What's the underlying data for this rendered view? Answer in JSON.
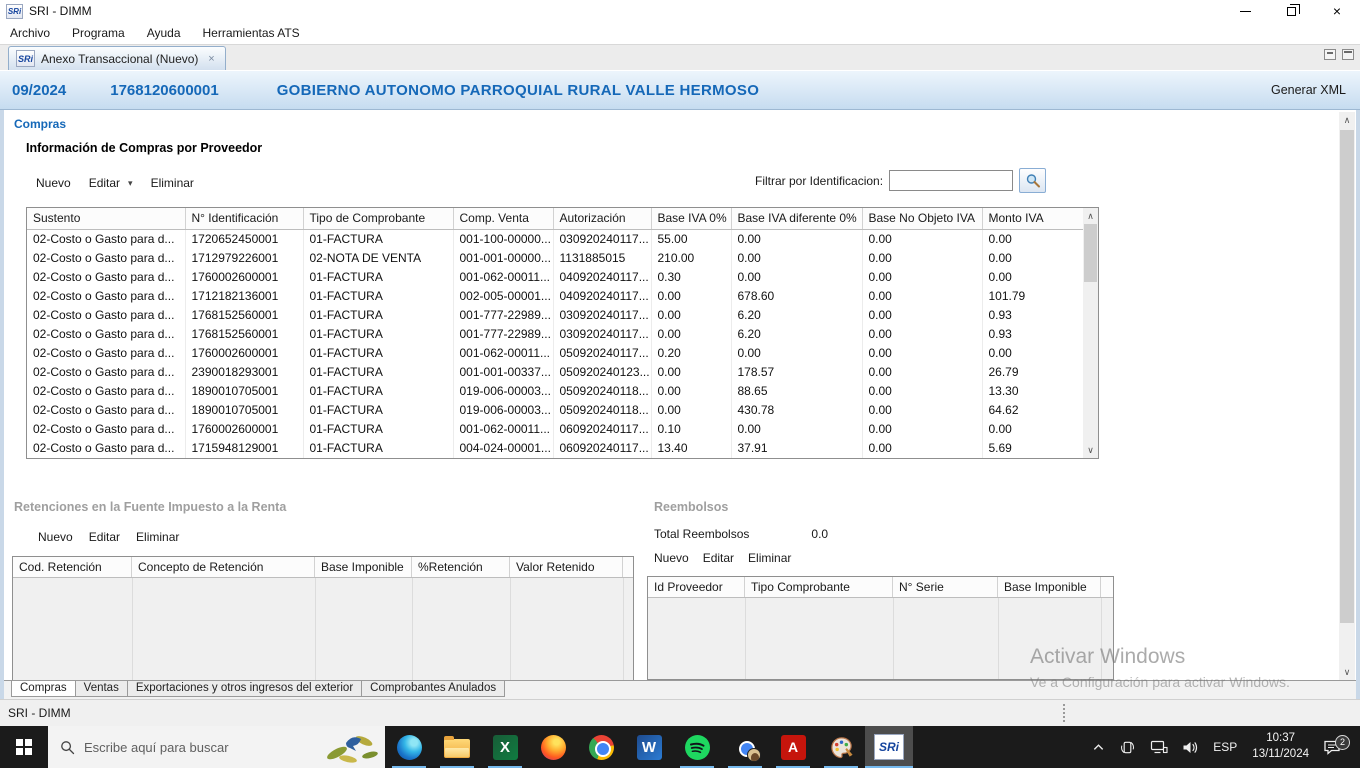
{
  "window": {
    "title": "SRI - DIMM",
    "logo_text": "SRi"
  },
  "menubar": {
    "items": [
      {
        "label": "Archivo"
      },
      {
        "label": "Programa"
      },
      {
        "label": "Ayuda"
      },
      {
        "label": "Herramientas ATS"
      }
    ]
  },
  "editor_tab": {
    "label": "Anexo Transaccional (Nuevo)"
  },
  "doc_header": {
    "period": "09/2024",
    "ruc": "1768120600001",
    "entity": "GOBIERNO AUTONOMO PARROQUIAL RURAL VALLE HERMOSO",
    "action": "Generar XML"
  },
  "compras": {
    "section_label": "Compras",
    "panel_title": "Información de Compras por Proveedor",
    "toolbar": {
      "nuevo": "Nuevo",
      "editar": "Editar",
      "eliminar": "Eliminar"
    },
    "filter": {
      "label": "Filtrar por Identificacion:",
      "value": ""
    },
    "table": {
      "headers": [
        "Sustento",
        "N° Identificación",
        "Tipo de Comprobante",
        "Comp. Venta",
        "Autorización",
        "Base IVA 0%",
        "Base IVA diferente 0%",
        "Base No Objeto IVA",
        "Monto IVA"
      ],
      "rows": [
        [
          "02-Costo o Gasto para d...",
          "1720652450001",
          "01-FACTURA",
          "001-100-00000...",
          "030920240117...",
          "55.00",
          "0.00",
          "0.00",
          "0.00"
        ],
        [
          "02-Costo o Gasto para d...",
          "1712979226001",
          "02-NOTA DE VENTA",
          "001-001-00000...",
          "1131885015",
          "210.00",
          "0.00",
          "0.00",
          "0.00"
        ],
        [
          "02-Costo o Gasto para d...",
          "1760002600001",
          "01-FACTURA",
          "001-062-00011...",
          "040920240117...",
          "0.30",
          "0.00",
          "0.00",
          "0.00"
        ],
        [
          "02-Costo o Gasto para d...",
          "1712182136001",
          "01-FACTURA",
          "002-005-00001...",
          "040920240117...",
          "0.00",
          "678.60",
          "0.00",
          "101.79"
        ],
        [
          "02-Costo o Gasto para d...",
          "1768152560001",
          "01-FACTURA",
          "001-777-22989...",
          "030920240117...",
          "0.00",
          "6.20",
          "0.00",
          "0.93"
        ],
        [
          "02-Costo o Gasto para d...",
          "1768152560001",
          "01-FACTURA",
          "001-777-22989...",
          "030920240117...",
          "0.00",
          "6.20",
          "0.00",
          "0.93"
        ],
        [
          "02-Costo o Gasto para d...",
          "1760002600001",
          "01-FACTURA",
          "001-062-00011...",
          "050920240117...",
          "0.20",
          "0.00",
          "0.00",
          "0.00"
        ],
        [
          "02-Costo o Gasto para d...",
          "2390018293001",
          "01-FACTURA",
          "001-001-00337...",
          "050920240123...",
          "0.00",
          "178.57",
          "0.00",
          "26.79"
        ],
        [
          "02-Costo o Gasto para d...",
          "1890010705001",
          "01-FACTURA",
          "019-006-00003...",
          "050920240118...",
          "0.00",
          "88.65",
          "0.00",
          "13.30"
        ],
        [
          "02-Costo o Gasto para d...",
          "1890010705001",
          "01-FACTURA",
          "019-006-00003...",
          "050920240118...",
          "0.00",
          "430.78",
          "0.00",
          "64.62"
        ],
        [
          "02-Costo o Gasto para d...",
          "1760002600001",
          "01-FACTURA",
          "001-062-00011...",
          "060920240117...",
          "0.10",
          "0.00",
          "0.00",
          "0.00"
        ],
        [
          "02-Costo o Gasto para d...",
          "1715948129001",
          "01-FACTURA",
          "004-024-00001...",
          "060920240117...",
          "13.40",
          "37.91",
          "0.00",
          "5.69"
        ]
      ]
    }
  },
  "retenciones": {
    "section_title": "Retenciones en la Fuente  Impuesto a la Renta",
    "toolbar": {
      "nuevo": "Nuevo",
      "editar": "Editar",
      "eliminar": "Eliminar"
    },
    "headers": [
      "Cod. Retención",
      "Concepto de Retención",
      "Base Imponible",
      "%Retención",
      "Valor Retenido"
    ]
  },
  "reembolsos": {
    "section_title": "Reembolsos",
    "total_label": "Total Reembolsos",
    "total_value": "0.0",
    "toolbar": {
      "nuevo": "Nuevo",
      "editar": "Editar",
      "eliminar": "Eliminar"
    },
    "headers": [
      "Id Proveedor",
      "Tipo Comprobante",
      "N° Serie",
      "Base Imponible"
    ]
  },
  "bottom_tabs": {
    "tabs": [
      {
        "label": "Compras"
      },
      {
        "label": "Ventas"
      },
      {
        "label": "Exportaciones y otros ingresos del exterior"
      },
      {
        "label": "Comprobantes Anulados"
      }
    ]
  },
  "statusbar": {
    "text": "SRI - DIMM"
  },
  "watermark": {
    "line1": "Activar Windows",
    "line2": "Ve a Configuración para activar Windows."
  },
  "taskbar": {
    "search": {
      "placeholder": "Escribe aquí para buscar"
    },
    "apps": [
      "edge",
      "file-explorer",
      "excel",
      "firefox",
      "chrome",
      "word",
      "spotify",
      "chrome-profile",
      "acrobat",
      "paint",
      "sri-dimm"
    ],
    "tile_letters": {
      "excel": "X",
      "word": "W",
      "acrobat": "A"
    },
    "tray": {
      "language": "ESP",
      "time": "10:37",
      "date": "13/11/2024",
      "notification_count": "2"
    }
  },
  "glyphs": {
    "close": "×",
    "dropdown": "▾",
    "scroll_up": "∧",
    "scroll_down": "∨"
  },
  "colors": {
    "accent_blue": "#1568b8",
    "running_indicator": "#76b9ed",
    "taskbar_bg": "#1b1b1b"
  }
}
